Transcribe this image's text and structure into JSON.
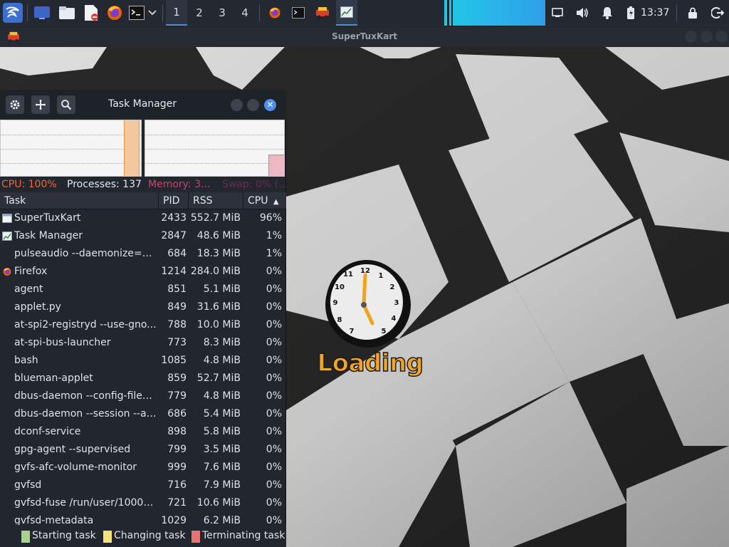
{
  "panel": {
    "workspaces": [
      "1",
      "2",
      "3",
      "4"
    ],
    "active_workspace": "1",
    "clock": "13:37",
    "icons": [
      "kali-menu-icon",
      "desktop-icon",
      "file-manager-icon",
      "text-editor-icon",
      "firefox-icon",
      "terminal-icon",
      "chevron-down-icon"
    ],
    "tray_icons": [
      "display-icon",
      "volume-icon",
      "notification-bell-icon",
      "battery-icon",
      "lock-icon",
      "logout-icon"
    ]
  },
  "game": {
    "title": "SuperTuxKart",
    "loading_text": "Loading"
  },
  "taskmanager": {
    "title": "Task Manager",
    "cpu_graph_fill": 1.0,
    "memory_graph_fill": 0.38,
    "stats": {
      "cpu": "CPU: 100%",
      "processes": "Processes: 137",
      "memory": "Memory: 3...",
      "swap": "Swap: 0% (..."
    },
    "columns": {
      "task": "Task",
      "pid": "PID",
      "rss": "RSS",
      "cpu": "CPU"
    },
    "sort_indicator": "▲",
    "rows": [
      {
        "name": "SuperTuxKart",
        "pid": "2433",
        "rss": "552.7 MiB",
        "cpu": "96%",
        "icon": "window-icon"
      },
      {
        "name": "Task Manager",
        "pid": "2847",
        "rss": "48.6 MiB",
        "cpu": "1%",
        "icon": "taskmanager-icon"
      },
      {
        "name": "pulseaudio --daemonize=no...",
        "pid": "684",
        "rss": "18.3 MiB",
        "cpu": "1%",
        "icon": ""
      },
      {
        "name": "Firefox",
        "pid": "1214",
        "rss": "284.0 MiB",
        "cpu": "0%",
        "icon": "firefox-icon"
      },
      {
        "name": "agent",
        "pid": "851",
        "rss": "5.1 MiB",
        "cpu": "0%",
        "icon": ""
      },
      {
        "name": "applet.py",
        "pid": "849",
        "rss": "31.6 MiB",
        "cpu": "0%",
        "icon": ""
      },
      {
        "name": "at-spi2-registryd --use-gno...",
        "pid": "788",
        "rss": "10.0 MiB",
        "cpu": "0%",
        "icon": ""
      },
      {
        "name": "at-spi-bus-launcher",
        "pid": "773",
        "rss": "8.3 MiB",
        "cpu": "0%",
        "icon": ""
      },
      {
        "name": "bash",
        "pid": "1085",
        "rss": "4.8 MiB",
        "cpu": "0%",
        "icon": ""
      },
      {
        "name": "blueman-applet",
        "pid": "859",
        "rss": "52.7 MiB",
        "cpu": "0%",
        "icon": ""
      },
      {
        "name": "dbus-daemon --config-file=...",
        "pid": "779",
        "rss": "4.8 MiB",
        "cpu": "0%",
        "icon": ""
      },
      {
        "name": "dbus-daemon --session --ad...",
        "pid": "686",
        "rss": "5.4 MiB",
        "cpu": "0%",
        "icon": ""
      },
      {
        "name": "dconf-service",
        "pid": "898",
        "rss": "5.8 MiB",
        "cpu": "0%",
        "icon": ""
      },
      {
        "name": "gpg-agent --supervised",
        "pid": "799",
        "rss": "3.5 MiB",
        "cpu": "0%",
        "icon": ""
      },
      {
        "name": "gvfs-afc-volume-monitor",
        "pid": "999",
        "rss": "7.6 MiB",
        "cpu": "0%",
        "icon": ""
      },
      {
        "name": "gvfsd",
        "pid": "716",
        "rss": "7.9 MiB",
        "cpu": "0%",
        "icon": ""
      },
      {
        "name": "gvfsd-fuse /run/user/1000/g...",
        "pid": "721",
        "rss": "10.6 MiB",
        "cpu": "0%",
        "icon": ""
      },
      {
        "name": "gvfsd-metadata",
        "pid": "1029",
        "rss": "6.2 MiB",
        "cpu": "0%",
        "icon": ""
      }
    ],
    "legend": {
      "starting": "Starting task",
      "changing": "Changing task",
      "terminating": "Terminating task"
    },
    "colors": {
      "cpu_fill": "#f4c89e",
      "cpu_edge": "#e8924a",
      "memory_fill": "#ebb8c4",
      "memory_edge": "#d47a94",
      "cpu_text": "#e86a3a",
      "memory_text": "#c2476e",
      "swap_text": "#6d2e47",
      "legend_starting": "#a9d18e",
      "legend_changing": "#f5e27a",
      "legend_terminating": "#e57373"
    }
  }
}
